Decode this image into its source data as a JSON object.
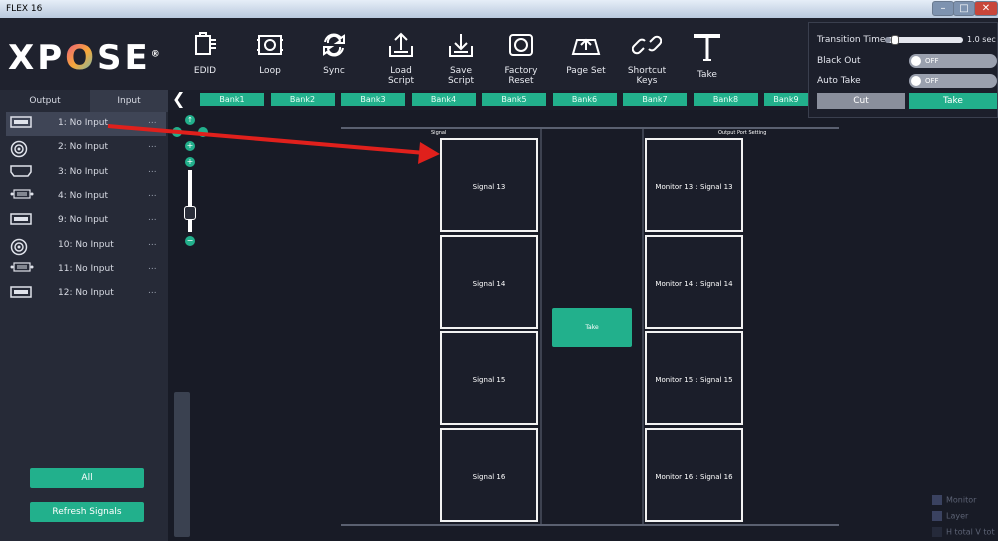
{
  "window": {
    "title": "FLEX 16",
    "minimize": "–",
    "maximize": "□",
    "close": "✕"
  },
  "logo": {
    "text_left": "X",
    "text_o1": "P",
    "text_mid": "O",
    "text_right": "SE",
    "reg": "®"
  },
  "toolbar": {
    "items": [
      {
        "label": "EDID",
        "icon": "edid-icon"
      },
      {
        "label": "Loop",
        "icon": "loop-icon"
      },
      {
        "label": "Sync",
        "icon": "sync-icon"
      },
      {
        "label": "Load Script",
        "icon": "load-script-icon"
      },
      {
        "label": "Save Script",
        "icon": "save-script-icon"
      },
      {
        "label": "Factory Reset",
        "icon": "factory-reset-icon"
      },
      {
        "label": "Page Set",
        "icon": "page-set-icon"
      },
      {
        "label": "Shortcut Keys",
        "icon": "shortcut-keys-icon"
      },
      {
        "label": "Take",
        "icon": "take-icon"
      }
    ]
  },
  "controls": {
    "transition_label": "Transition Time",
    "transition_value": "1.0",
    "transition_unit": "sec",
    "transition_fraction": 0.08,
    "blackout_label": "Black Out",
    "blackout_state": "OFF",
    "autotake_label": "Auto Take",
    "autotake_state": "OFF",
    "cut_label": "Cut",
    "take_label": "Take"
  },
  "left_panel": {
    "tab_output": "Output",
    "tab_input": "Input",
    "inputs": [
      {
        "label": "1: No Input",
        "icon": "dp-port-icon",
        "more": "..."
      },
      {
        "label": "2: No Input",
        "icon": "sdi-port-icon",
        "more": "..."
      },
      {
        "label": "3: No Input",
        "icon": "hdmi-port-icon",
        "more": "..."
      },
      {
        "label": "4: No Input",
        "icon": "dvi-port-icon",
        "more": "..."
      },
      {
        "label": "9: No Input",
        "icon": "dp-port-icon",
        "more": "..."
      },
      {
        "label": "10: No Input",
        "icon": "sdi-port-icon",
        "more": "..."
      },
      {
        "label": "11: No Input",
        "icon": "dvi-port-icon",
        "more": "..."
      },
      {
        "label": "12: No Input",
        "icon": "dp-port-icon",
        "more": "..."
      }
    ],
    "all_label": "All",
    "refresh_label": "Refresh Signals"
  },
  "banks": [
    "Bank1",
    "Bank2",
    "Bank3",
    "Bank4",
    "Bank5",
    "Bank6",
    "Bank7",
    "Bank8",
    "Bank9"
  ],
  "canvas": {
    "signal_header": "Signal",
    "output_header": "Output Port  Setting",
    "take_label": "Take",
    "signals": [
      "Signal 13",
      "Signal 14",
      "Signal 15",
      "Signal 16"
    ],
    "monitors": [
      "Monitor  13 : Signal 13",
      "Monitor  14 : Signal 14",
      "Monitor  15 : Signal 15",
      "Monitor  16 : Signal 16"
    ],
    "zoom": {
      "up": "↑",
      "plus": "+",
      "minus": "−"
    }
  },
  "checkboxes": [
    "Monitor",
    "Layer",
    "H total V tot"
  ],
  "colors": {
    "accent": "#22b08c",
    "arrow": "#e0201c"
  }
}
